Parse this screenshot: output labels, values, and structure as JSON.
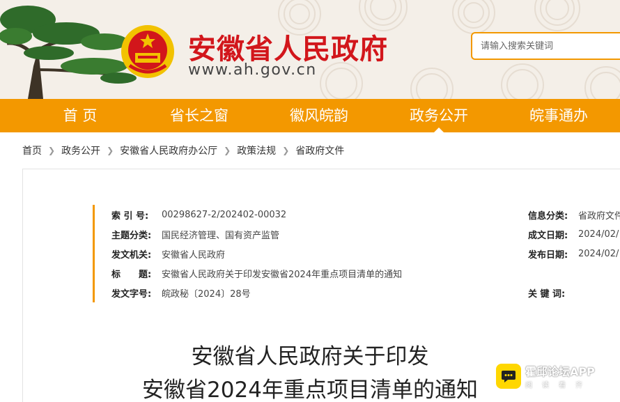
{
  "header": {
    "site_title": "安徽省人民政府",
    "site_domain": "www.ah.gov.cn",
    "search_placeholder": "请输入搜索关键词",
    "brand_color": "#d2161b",
    "accent_color": "#f39800"
  },
  "nav": {
    "items": [
      {
        "label": "首 页"
      },
      {
        "label": "省长之窗"
      },
      {
        "label": "徽风皖韵"
      },
      {
        "label": "政务公开",
        "active": true
      },
      {
        "label": "皖事通办"
      }
    ]
  },
  "breadcrumb": {
    "items": [
      "首页",
      "政务公开",
      "安徽省人民政府办公厅",
      "政策法规",
      "省政府文件"
    ]
  },
  "meta": {
    "left": [
      {
        "label": "索 引 号:",
        "value": "00298627-2/202402-00032"
      },
      {
        "label": "主题分类:",
        "value": "国民经济管理、国有资产监管"
      },
      {
        "label": "发文机关:",
        "value": "安徽省人民政府"
      },
      {
        "label": "标　　题:",
        "value": "安徽省人民政府关于印发安徽省2024年重点项目清单的通知"
      },
      {
        "label": "发文字号:",
        "value": "皖政秘〔2024〕28号"
      }
    ],
    "right": [
      {
        "label": "信息分类:",
        "value": "省政府文件"
      },
      {
        "label": "成文日期:",
        "value": "2024/02/"
      },
      {
        "label": "发布日期:",
        "value": "2024/02/"
      },
      {
        "label": "关 键 词:",
        "value": ""
      }
    ]
  },
  "document": {
    "title_line1": "安徽省人民政府关于印发",
    "title_line2": "安徽省2024年重点项目清单的通知"
  },
  "app_badge": {
    "name": "霍邱论坛APP",
    "subtitle": "阅读看齐"
  }
}
